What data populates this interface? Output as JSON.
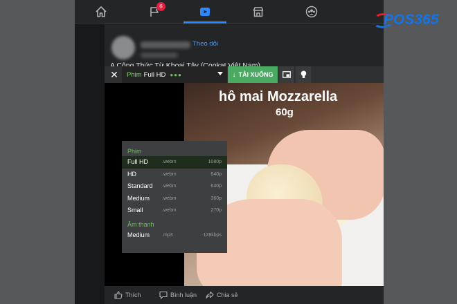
{
  "navbar": {
    "badge_count": "6",
    "items": [
      "home-icon",
      "flag-icon",
      "video-icon",
      "marketplace-icon",
      "groups-icon"
    ],
    "active": "video-icon"
  },
  "post": {
    "follow_label": "Theo dõi",
    "caption": "A Công Thức Từ Khoai Tây (Cookat Việt Nam)",
    "video": {
      "title_text": "hô mai Mozzarella",
      "subtitle_text": "60g"
    },
    "actions": {
      "like": "Thích",
      "comment": "Bình luận",
      "share": "Chia sẻ"
    }
  },
  "downloader": {
    "close_label": "✕",
    "quality_type": "Phim",
    "quality_value": "Full HD",
    "quality_dots": "●●●",
    "download_label": "TẢI XUỐNG",
    "download_arrow": "↓",
    "groups": [
      {
        "label": "Phim",
        "options": [
          {
            "name": "Full HD",
            "format": ".webm",
            "resolution": "1080p",
            "selected": true
          },
          {
            "name": "HD",
            "format": ".webm",
            "resolution": "640p"
          },
          {
            "name": "Standard",
            "format": ".webm",
            "resolution": "640p"
          },
          {
            "name": "Medium",
            "format": ".webm",
            "resolution": "360p"
          },
          {
            "name": "Small",
            "format": ".webm",
            "resolution": "270p"
          }
        ]
      },
      {
        "label": "Âm thanh",
        "options": [
          {
            "name": "Medium",
            "format": ".mp3",
            "resolution": "128kbps"
          }
        ]
      }
    ]
  },
  "watermark": {
    "brand": "POS365"
  },
  "colors": {
    "accent_blue": "#2d88ff",
    "download_green": "#4aaa62",
    "group_green": "#6bc35a",
    "badge_red": "#e41e3f",
    "logo_blue": "#1473e6"
  }
}
